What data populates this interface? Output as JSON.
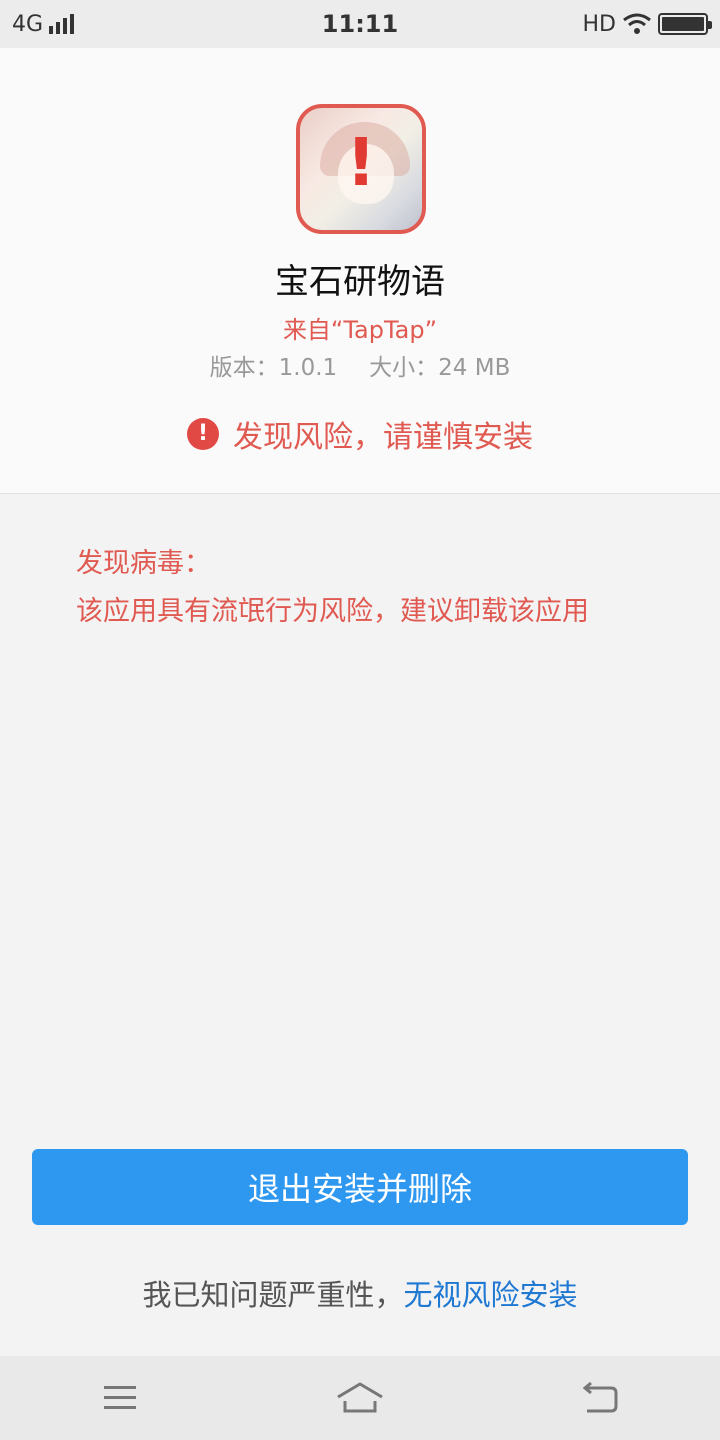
{
  "status_bar": {
    "network": "4G",
    "time": "11:11",
    "hd": "HD"
  },
  "app": {
    "name": "宝石研物语",
    "source": "来自“TapTap”",
    "version": "版本：1.0.1",
    "size": "大小：24 MB",
    "icon_alert": "!"
  },
  "risk": {
    "icon": "!",
    "message": "发现风险，请谨慎安装"
  },
  "virus": {
    "title": "发现病毒：",
    "description": "该应用具有流氓行为风险，建议卸载该应用"
  },
  "actions": {
    "primary_button": "退出安装并删除",
    "ignore_prefix": "我已知问题严重性，",
    "ignore_link": "无视风险安装"
  },
  "colors": {
    "danger": "#e05a52",
    "primary": "#2e98f0",
    "link": "#1f78d1"
  },
  "icons": {
    "nav": [
      "menu-icon",
      "home-icon",
      "back-icon"
    ]
  }
}
